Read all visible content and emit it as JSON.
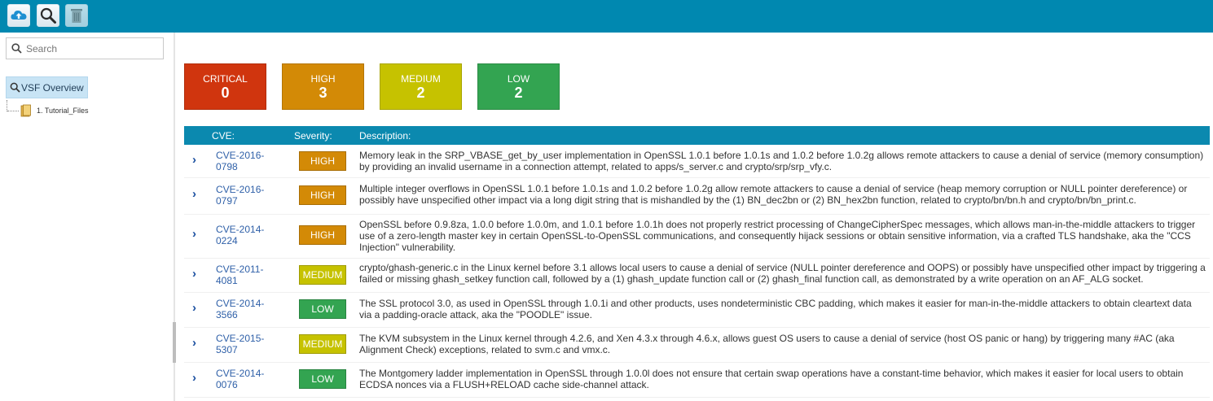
{
  "toolbar": {
    "upload_icon": "cloud-upload-icon",
    "search_icon": "magnifier-icon",
    "trash_icon": "trash-icon"
  },
  "sidebar": {
    "search_placeholder": "Search",
    "overview_label": "VSF Overview",
    "tree_items": [
      {
        "label": "1. Tutorial_Files"
      }
    ]
  },
  "summary": {
    "critical": {
      "label": "CRITICAL",
      "count": "0",
      "color": "#d0350e"
    },
    "high": {
      "label": "HIGH",
      "count": "3",
      "color": "#d38a06"
    },
    "medium": {
      "label": "MEDIUM",
      "count": "2",
      "color": "#c6c200"
    },
    "low": {
      "label": "LOW",
      "count": "2",
      "color": "#33a451"
    }
  },
  "table": {
    "headers": {
      "cve": "CVE:",
      "severity": "Severity:",
      "description": "Description:"
    },
    "rows": [
      {
        "cve1": "CVE-2016-",
        "cve2": "0798",
        "severity": "HIGH",
        "description": "Memory leak in the SRP_VBASE_get_by_user implementation in OpenSSL 1.0.1 before 1.0.1s and 1.0.2 before 1.0.2g allows remote attackers to cause a denial of service (memory consumption) by providing an invalid username in a connection attempt, related to apps/s_server.c and crypto/srp/srp_vfy.c."
      },
      {
        "cve1": "CVE-2016-",
        "cve2": "0797",
        "severity": "HIGH",
        "description": "Multiple integer overflows in OpenSSL 1.0.1 before 1.0.1s and 1.0.2 before 1.0.2g allow remote attackers to cause a denial of service (heap memory corruption or NULL pointer dereference) or possibly have unspecified other impact via a long digit string that is mishandled by the (1) BN_dec2bn or (2) BN_hex2bn function, related to crypto/bn/bn.h and crypto/bn/bn_print.c."
      },
      {
        "cve1": "CVE-2014-",
        "cve2": "0224",
        "severity": "HIGH",
        "description": "OpenSSL before 0.9.8za, 1.0.0 before 1.0.0m, and 1.0.1 before 1.0.1h does not properly restrict processing of ChangeCipherSpec messages, which allows man-in-the-middle attackers to trigger use of a zero-length master key in certain OpenSSL-to-OpenSSL communications, and consequently hijack sessions or obtain sensitive information, via a crafted TLS handshake, aka the \"CCS Injection\" vulnerability."
      },
      {
        "cve1": "CVE-2011-",
        "cve2": "4081",
        "severity": "MEDIUM",
        "description": "crypto/ghash-generic.c in the Linux kernel before 3.1 allows local users to cause a denial of service (NULL pointer dereference and OOPS) or possibly have unspecified other impact by triggering a failed or missing ghash_setkey function call, followed by a (1) ghash_update function call or (2) ghash_final function call, as demonstrated by a write operation on an AF_ALG socket."
      },
      {
        "cve1": "CVE-2014-",
        "cve2": "3566",
        "severity": "LOW",
        "description": "The SSL protocol 3.0, as used in OpenSSL through 1.0.1i and other products, uses nondeterministic CBC padding, which makes it easier for man-in-the-middle attackers to obtain cleartext data via a padding-oracle attack, aka the \"POODLE\" issue."
      },
      {
        "cve1": "CVE-2015-",
        "cve2": "5307",
        "severity": "MEDIUM",
        "description": "The KVM subsystem in the Linux kernel through 4.2.6, and Xen 4.3.x through 4.6.x, allows guest OS users to cause a denial of service (host OS panic or hang) by triggering many #AC (aka Alignment Check) exceptions, related to svm.c and vmx.c."
      },
      {
        "cve1": "CVE-2014-",
        "cve2": "0076",
        "severity": "LOW",
        "description": "The Montgomery ladder implementation in OpenSSL through 1.0.0l does not ensure that certain swap operations have a constant-time behavior, which makes it easier for local users to obtain ECDSA nonces via a FLUSH+RELOAD cache side-channel attack."
      }
    ]
  }
}
